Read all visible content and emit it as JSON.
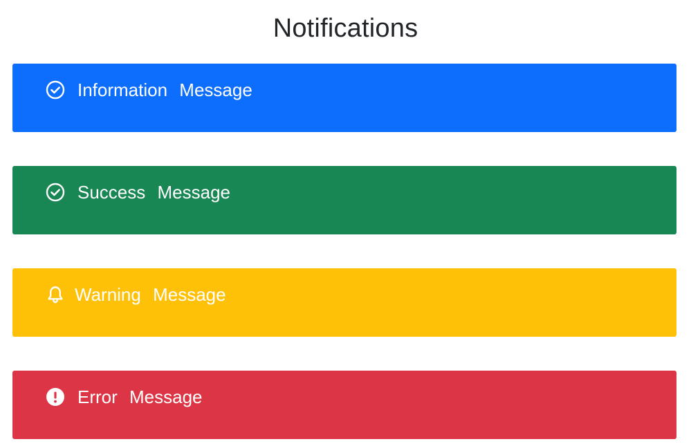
{
  "page": {
    "title": "Notifications"
  },
  "notifications": [
    {
      "type": "info",
      "text": "Information  Message",
      "icon": "check-circle-icon",
      "color": "#0d6efd"
    },
    {
      "type": "success",
      "text": "Success  Message",
      "icon": "check-circle-icon",
      "color": "#198754"
    },
    {
      "type": "warning",
      "text": "Warning  Message",
      "icon": "bell-icon",
      "color": "#ffc107"
    },
    {
      "type": "error",
      "text": "Error  Message",
      "icon": "exclamation-circle-icon",
      "color": "#dc3545"
    }
  ]
}
